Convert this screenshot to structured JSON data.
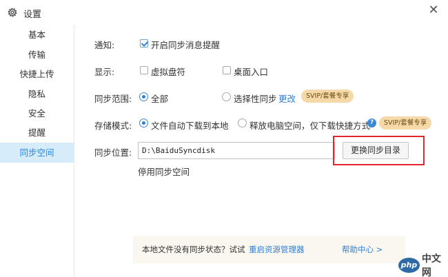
{
  "window": {
    "title": "设置",
    "close_glyph": "✕",
    "icons": {
      "title": "gear-icon",
      "close": "close-icon"
    }
  },
  "sidebar": {
    "items": [
      {
        "label": "基本"
      },
      {
        "label": "传输"
      },
      {
        "label": "快捷上传"
      },
      {
        "label": "隐私"
      },
      {
        "label": "安全"
      },
      {
        "label": "提醒"
      },
      {
        "label": "同步空间",
        "active": true
      }
    ]
  },
  "main": {
    "notify": {
      "label": "通知:",
      "option": "开启同步消息提醒",
      "checked": true
    },
    "display": {
      "label": "显示:",
      "options": [
        {
          "text": "虚拟盘符",
          "checked": false
        },
        {
          "text": "桌面入口",
          "checked": false
        }
      ]
    },
    "sync_scope": {
      "label": "同步范围:",
      "options": [
        {
          "text": "全部",
          "selected": true
        },
        {
          "text": "选择性同步",
          "selected": false
        }
      ],
      "change_link": "更改",
      "badge": "SVIP/套餐专享"
    },
    "storage_mode": {
      "label": "存储模式:",
      "options": [
        {
          "text": "文件自动下载到本地",
          "selected": true
        },
        {
          "text": "释放电脑空间，仅下载快捷方式",
          "selected": false
        }
      ],
      "help_glyph": "?",
      "badge": "SVIP/套餐专享"
    },
    "sync_location": {
      "label": "同步位置:",
      "path": "D:\\BaiduSyncdisk",
      "change_button": "更换同步目录",
      "disable_link": "停用同步空间"
    },
    "banner": {
      "text": "本地文件没有同步状态？试试",
      "restart_link": "重启资源管理器",
      "help_link": "帮助中心 >"
    }
  },
  "watermark": {
    "logo": "php",
    "text": "中文网"
  },
  "colors": {
    "accent": "#2f80d6",
    "active_bg": "#d7ecfb",
    "badge_bg": "#f5d9a8",
    "highlight": "#e3242b"
  }
}
